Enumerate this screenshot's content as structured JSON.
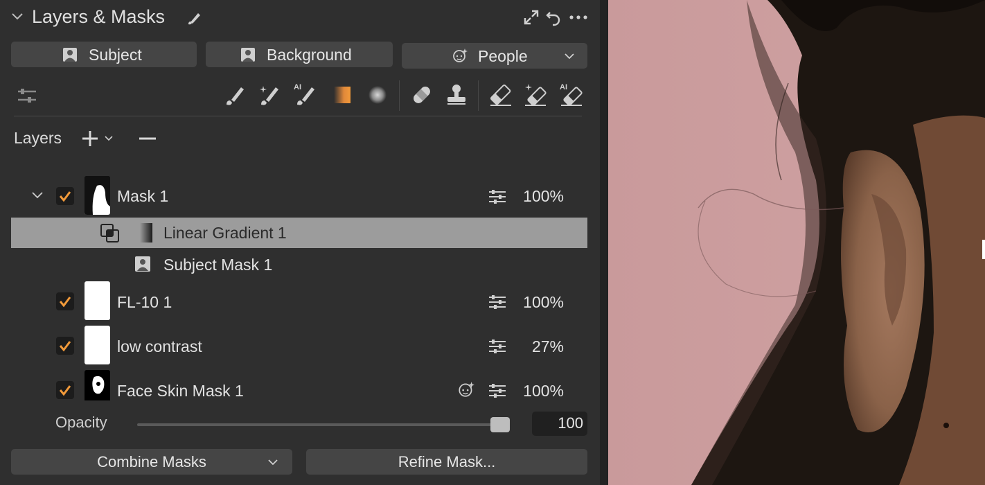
{
  "header": {
    "title": "Layers & Masks",
    "icons": [
      "chevron-down-icon",
      "brush-edit-icon",
      "expand-icon",
      "undo-icon",
      "more-icon"
    ]
  },
  "quick_masks": [
    {
      "label": "Subject",
      "icon": "person-square-icon"
    },
    {
      "label": "Background",
      "icon": "person-square-icon"
    },
    {
      "label": "People",
      "icon": "face-sparkle-icon",
      "dropdown": true
    }
  ],
  "tools": [
    "adjustments-icon",
    "brush-icon",
    "magic-brush-icon",
    "ai-brush-icon",
    "linear-gradient-icon",
    "radial-gradient-icon",
    "healing-icon",
    "clone-stamp-icon",
    "eraser-icon",
    "magic-eraser-icon",
    "ai-eraser-icon"
  ],
  "layers_panel": {
    "label": "Layers",
    "add_icon": "plus-icon",
    "remove_icon": "minus-icon"
  },
  "layers": [
    {
      "name": "Mask 1",
      "checked": true,
      "opacity": "100%",
      "expanded": true
    },
    {
      "name": "Linear Gradient 1",
      "sub": true,
      "selected": true
    },
    {
      "name": "Subject Mask 1",
      "sub": true
    },
    {
      "name": "FL-10 1",
      "checked": true,
      "opacity": "100%"
    },
    {
      "name": "low contrast",
      "checked": true,
      "opacity": "27%"
    },
    {
      "name": "Face Skin Mask 1",
      "checked": true,
      "opacity": "100%",
      "face_icon": true
    }
  ],
  "opacity": {
    "label": "Opacity",
    "value": "100",
    "level": 1.0
  },
  "bottom_buttons": {
    "combine": "Combine Masks",
    "refine": "Refine Mask..."
  },
  "colors": {
    "accent": "#f29a3a",
    "panel": "#2f2f2f",
    "selection": "#9c9c9c",
    "photo_bg": "#c9999a"
  }
}
